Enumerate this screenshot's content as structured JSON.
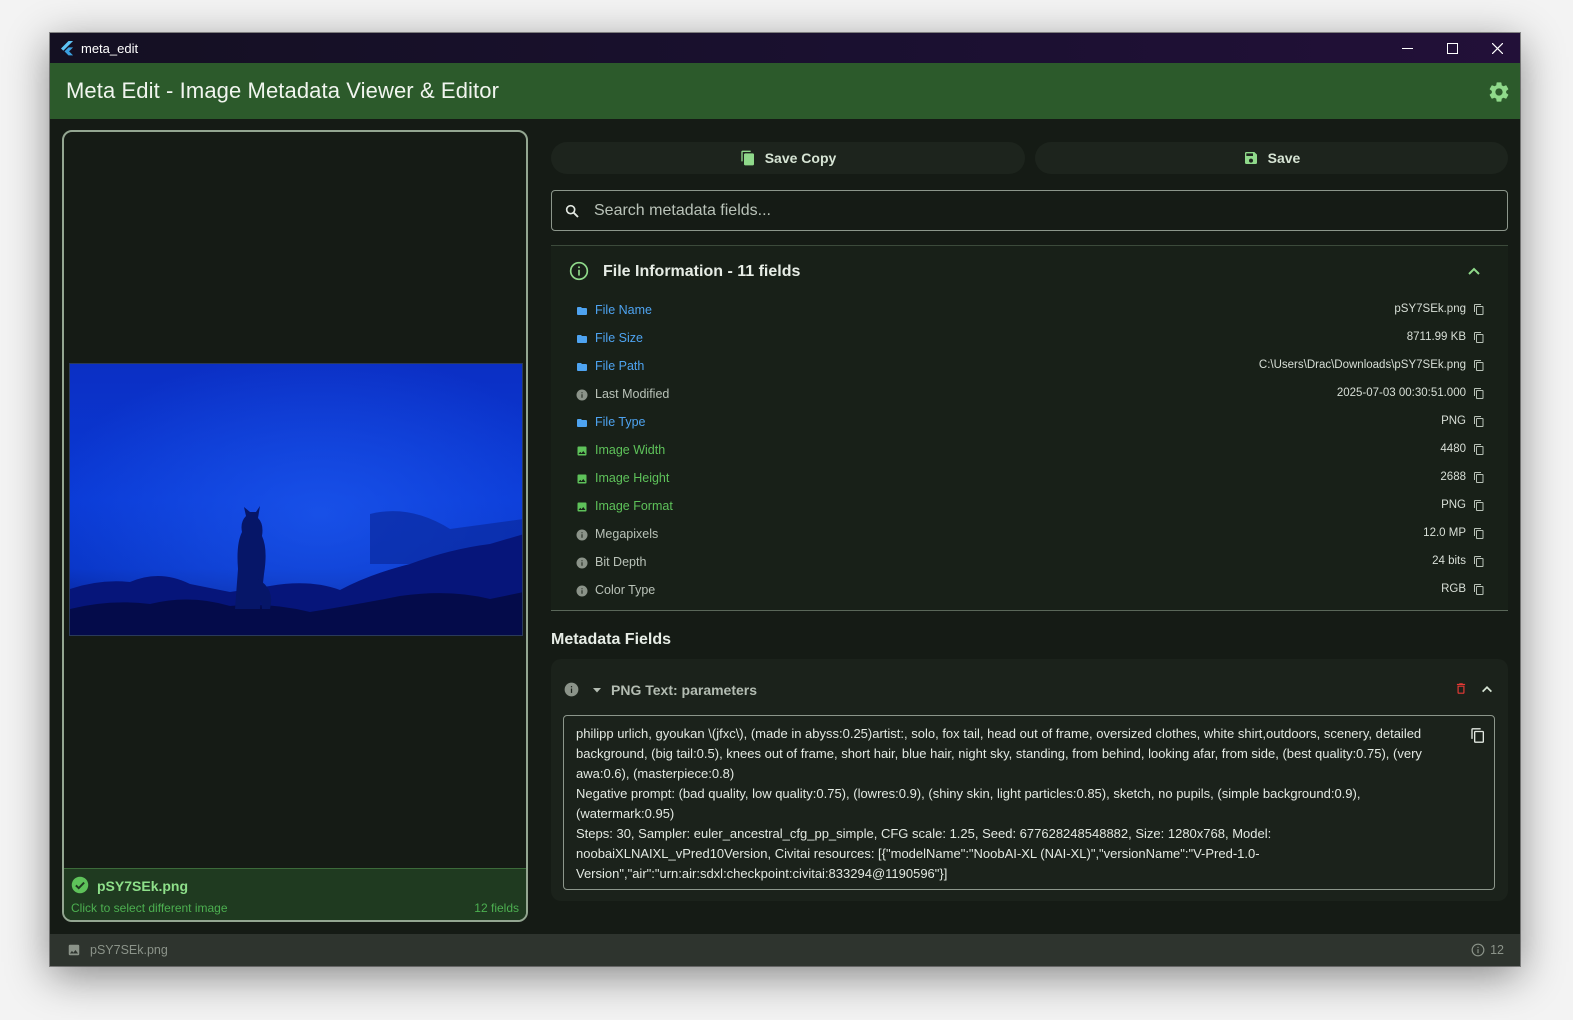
{
  "window": {
    "title": "meta_edit",
    "minimize_icon": "minimize-icon",
    "maximize_icon": "maximize-icon",
    "close_icon": "close-icon"
  },
  "appbar": {
    "title": "Meta Edit - Image Metadata Viewer & Editor",
    "settings_icon": "gear-icon",
    "color": "#2c5a2b"
  },
  "left_panel": {
    "file_name": "pSY7SEk.png",
    "hint": "Click to select different image",
    "field_count": "12 fields",
    "status_icon": "check-circle-icon"
  },
  "actions": {
    "save_copy_label": "Save Copy",
    "save_label": "Save"
  },
  "search": {
    "placeholder": "Search metadata fields...",
    "value": ""
  },
  "file_info": {
    "title": "File Information - 11 fields",
    "rows": [
      {
        "label": "File Name",
        "value": "pSY7SEk.png",
        "icon": "folder-icon",
        "color": "blue"
      },
      {
        "label": "File Size",
        "value": "8711.99 KB",
        "icon": "folder-icon",
        "color": "blue"
      },
      {
        "label": "File Path",
        "value": "C:\\Users\\Drac\\Downloads\\pSY7SEk.png",
        "icon": "folder-icon",
        "color": "blue"
      },
      {
        "label": "Last Modified",
        "value": "2025-07-03 00:30:51.000",
        "icon": "info-icon",
        "color": "gray"
      },
      {
        "label": "File Type",
        "value": "PNG",
        "icon": "folder-icon",
        "color": "blue"
      },
      {
        "label": "Image Width",
        "value": "4480",
        "icon": "image-icon",
        "color": "green"
      },
      {
        "label": "Image Height",
        "value": "2688",
        "icon": "image-icon",
        "color": "green"
      },
      {
        "label": "Image Format",
        "value": "PNG",
        "icon": "image-icon",
        "color": "green"
      },
      {
        "label": "Megapixels",
        "value": "12.0 MP",
        "icon": "info-icon",
        "color": "gray"
      },
      {
        "label": "Bit Depth",
        "value": "24 bits",
        "icon": "info-icon",
        "color": "gray"
      },
      {
        "label": "Color Type",
        "value": "RGB",
        "icon": "info-icon",
        "color": "gray"
      }
    ]
  },
  "metadata": {
    "section_title": "Metadata Fields",
    "field_title": "PNG Text: parameters",
    "field_value": "philipp urlich, gyoukan \\(jfxc\\), (made in abyss:0.25)artist:, solo, fox tail, head out of frame, oversized clothes, white shirt,outdoors, scenery, detailed background, (big tail:0.5), knees out of frame, short hair, blue hair, night sky, standing, from behind, looking afar, from side, (best quality:0.75), (very awa:0.6), (masterpiece:0.8)\nNegative prompt: (bad quality, low quality:0.75), (lowres:0.9), (shiny skin, light particles:0.85), sketch, no pupils, (simple background:0.9), (watermark:0.95)\nSteps: 30, Sampler: euler_ancestral_cfg_pp_simple, CFG scale: 1.25, Seed: 677628248548882, Size: 1280x768, Model: noobaiXLNAIXL_vPred10Version, Civitai resources: [{\"modelName\":\"NoobAI-XL (NAI-XL)\",\"versionName\":\"V-Pred-1.0-Version\",\"air\":\"urn:air:sdxl:checkpoint:civitai:833294@1190596\"}]"
  },
  "statusbar": {
    "file_name": "pSY7SEk.png",
    "count": "12"
  }
}
